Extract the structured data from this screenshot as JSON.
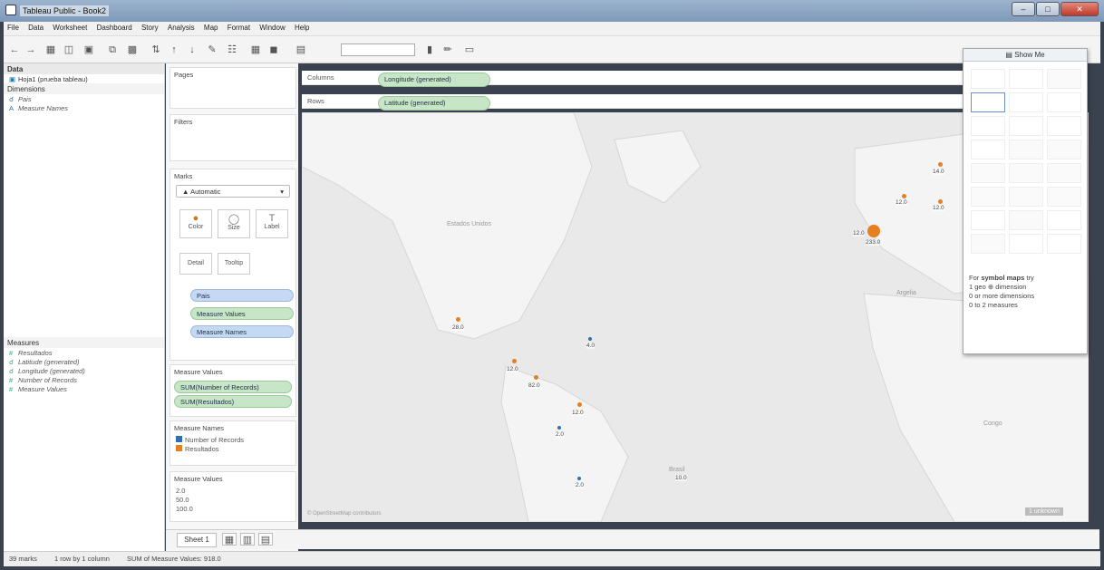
{
  "window": {
    "title": "Tableau Public - Book2"
  },
  "menu": [
    "File",
    "Data",
    "Worksheet",
    "Dashboard",
    "Story",
    "Analysis",
    "Map",
    "Format",
    "Window",
    "Help"
  ],
  "data_pane": {
    "header": "Data",
    "datasource": "Hoja1 (prueba tableau)",
    "dimensions_label": "Dimensions",
    "dimensions": [
      "Pais",
      "Measure Names"
    ],
    "measures_label": "Measures",
    "measures": [
      "Resultados",
      "Latitude (generated)",
      "Longitude (generated)",
      "Number of Records",
      "Measure Values"
    ]
  },
  "shelves": {
    "pages": "Pages",
    "filters": "Filters",
    "marks": "Marks",
    "mark_type": "Automatic",
    "color": "Color",
    "size": "Size",
    "label": "Label",
    "detail": "Detail",
    "tooltip": "Tooltip",
    "pills": [
      "Pais",
      "Measure Values",
      "Measure Names"
    ],
    "measure_values_title": "Measure Values",
    "measure_values_pills": [
      "SUM(Number of Records)",
      "SUM(Resultados)"
    ],
    "legend_title": "Measure Names",
    "legend_items": [
      "Number of Records",
      "Resultados"
    ],
    "size_legend_title": "Measure Values",
    "size_legend_items": [
      "2.0",
      "50.0",
      "100.0"
    ]
  },
  "columns": {
    "label": "Columns",
    "pill": "Longitude (generated)"
  },
  "rows": {
    "label": "Rows",
    "pill": "Latitude (generated)"
  },
  "map": {
    "labels": [
      "Estados Unidos",
      "Argelia",
      "Brasil",
      "Congo"
    ],
    "marks": [
      "14.0",
      "12.0",
      "12.0",
      "233.0",
      "12.0",
      "28.0",
      "4.0",
      "12.0",
      "82.0",
      "12.0",
      "2.0",
      "2.0",
      "10.0"
    ],
    "attribution": "© OpenStreetMap contributors",
    "unknown": "1 unknown"
  },
  "showme": {
    "title": "Show Me",
    "hint_prefix": "For",
    "hint_keyword": "symbol maps",
    "hint_suffix": "try",
    "hint_lines": [
      "1 geo ⊕ dimension",
      "0 or more dimensions",
      "0 to 2 measures"
    ]
  },
  "tabs": {
    "sheet": "Sheet 1"
  },
  "status": {
    "marks": "39 marks",
    "rows_cols": "1 row by 1 column",
    "sum": "SUM of Measure Values: 918.0"
  }
}
